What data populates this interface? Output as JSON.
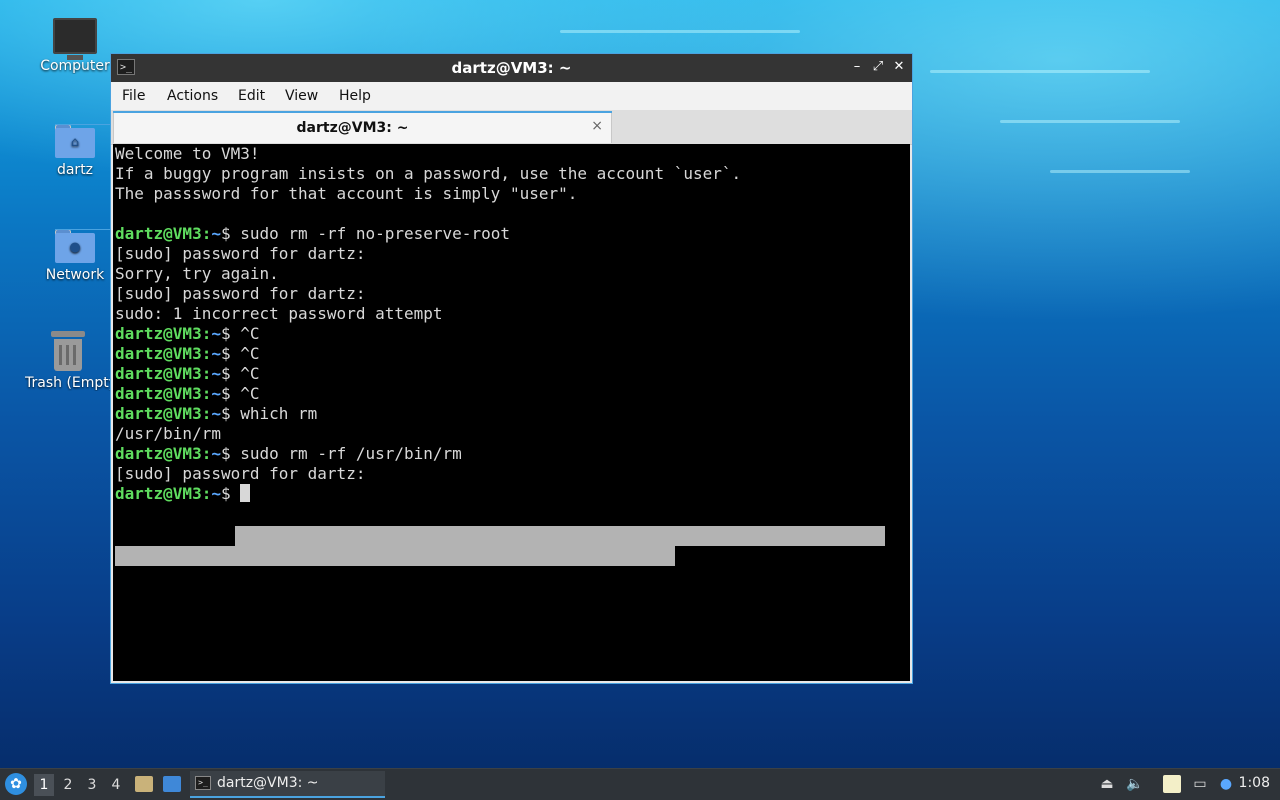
{
  "desktop": {
    "icons": [
      {
        "label": "Computer",
        "icon": "computer-icon"
      },
      {
        "label": "dartz",
        "icon": "home-folder-icon"
      },
      {
        "label": "Network",
        "icon": "network-folder-icon"
      },
      {
        "label": "Trash (Empty)",
        "icon": "trash-icon"
      }
    ]
  },
  "window": {
    "title": "dartz@VM3: ~",
    "menu": [
      "File",
      "Actions",
      "Edit",
      "View",
      "Help"
    ],
    "tab_label": "dartz@VM3: ~",
    "tab_close": "×",
    "controls": {
      "minimize": "–",
      "maximize": "⤢",
      "close": "✕"
    }
  },
  "terminal": {
    "prompt_user": "dartz@VM3",
    "prompt_sep": ":",
    "prompt_path": "~",
    "prompt_dollar": "$ ",
    "lines": [
      {
        "type": "text",
        "text": "Welcome to VM3!"
      },
      {
        "type": "text",
        "text": "If a buggy program insists on a password, use the account `user`."
      },
      {
        "type": "text",
        "text": "The passsword for that account is simply \"user\"."
      },
      {
        "type": "text",
        "text": ""
      },
      {
        "type": "prompt",
        "cmd": "sudo rm -rf no-preserve-root"
      },
      {
        "type": "text",
        "text": "[sudo] password for dartz:"
      },
      {
        "type": "text",
        "text": "Sorry, try again."
      },
      {
        "type": "text",
        "text": "[sudo] password for dartz:"
      },
      {
        "type": "text",
        "text": "sudo: 1 incorrect password attempt"
      },
      {
        "type": "prompt",
        "cmd": "^C"
      },
      {
        "type": "prompt",
        "cmd": "^C"
      },
      {
        "type": "prompt",
        "cmd": "^C"
      },
      {
        "type": "prompt",
        "cmd": "^C"
      },
      {
        "type": "prompt",
        "cmd": "which rm"
      },
      {
        "type": "text",
        "text": "/usr/bin/rm"
      },
      {
        "type": "prompt",
        "cmd": "sudo rm -rf /usr/bin/rm"
      },
      {
        "type": "text",
        "text": "[sudo] password for dartz:"
      },
      {
        "type": "prompt",
        "cmd": "",
        "cursor": true
      }
    ]
  },
  "taskbar": {
    "workspaces": [
      "1",
      "2",
      "3",
      "4"
    ],
    "active_workspace": "1",
    "task_label": "dartz@VM3: ~",
    "clock": "1:08",
    "tray_icons": [
      "eject-icon",
      "volume-icon",
      "clipboard-icon",
      "network-icon",
      "notification-icon"
    ]
  },
  "colors": {
    "prompt_user": "#5fdd5f",
    "prompt_path": "#5aa8ff",
    "accent": "#4aa3e0",
    "terminal_bg": "#000000",
    "redaction": "#b3b3b3"
  }
}
